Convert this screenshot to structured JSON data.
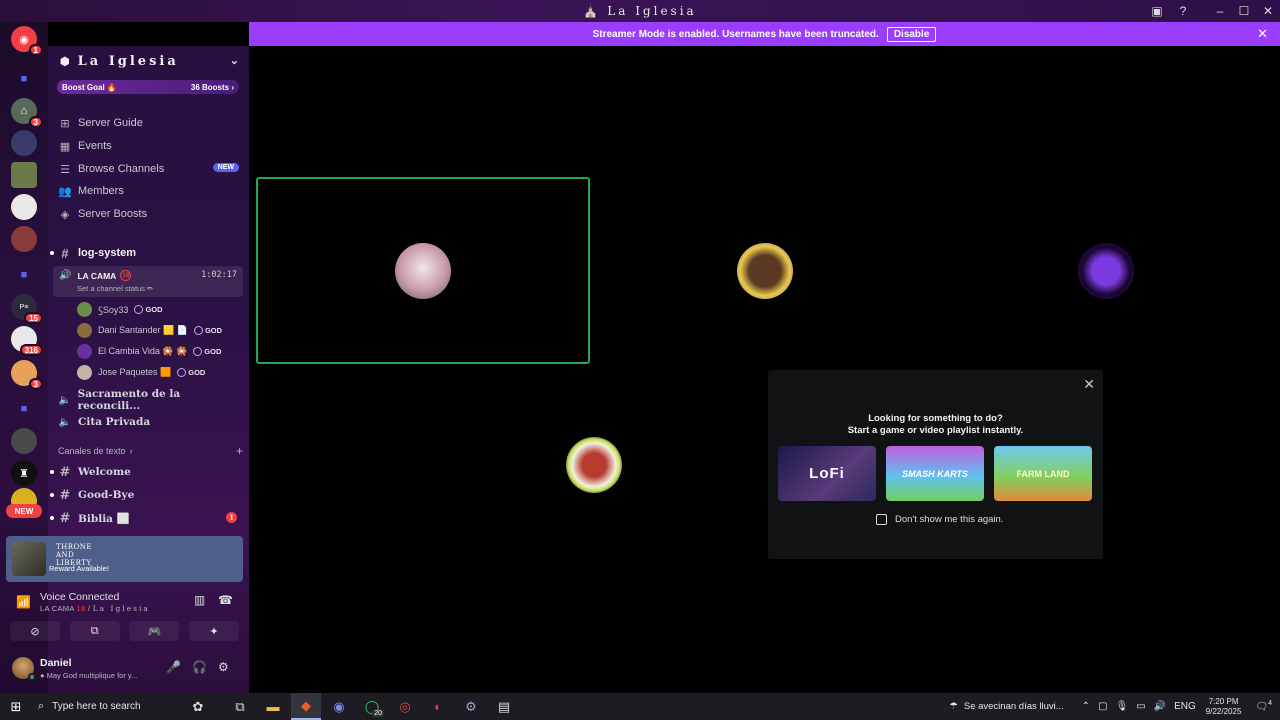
{
  "window": {
    "title": "La Iglesia",
    "icons": [
      "church-icon",
      "inbox-icon",
      "help-icon"
    ],
    "controls": [
      "minimize",
      "maximize",
      "close"
    ]
  },
  "banner": {
    "text": "Streamer Mode is enabled. Usernames have been truncated.",
    "button": "Disable"
  },
  "rail": {
    "badges": [
      "1",
      "3",
      "15",
      "316",
      "3"
    ],
    "new_label": "NEW"
  },
  "server": {
    "name": "La Iglesia",
    "boost_goal": "Boost Goal 🔥",
    "boost_count": "36 Boosts",
    "nav": [
      {
        "label": "Server Guide",
        "icon": "compass-icon"
      },
      {
        "label": "Events",
        "icon": "calendar-icon"
      },
      {
        "label": "Browse Channels",
        "icon": "list-icon",
        "tag": "NEW"
      },
      {
        "label": "Members",
        "icon": "members-icon"
      },
      {
        "label": "Server Boosts",
        "icon": "boost-icon"
      }
    ],
    "channels": {
      "log": "log-system",
      "voice_active": {
        "name": "LA CAMA",
        "age": "18",
        "timer": "1:02:17",
        "status": "Set a channel status ✏"
      },
      "members": [
        {
          "name": "ꚂSoy33",
          "role": "GOD",
          "color": "#6b8f4a"
        },
        {
          "name": "Dani Santander 🟨 📄",
          "role": "GOD",
          "color": "#8a6a3f"
        },
        {
          "name": "El Cambia Vida 🎇 🎇",
          "role": "GOD",
          "color": "#6a2fa0"
        },
        {
          "name": "Jose Paquetes 🟧",
          "role": "GOD",
          "color": "#c2b2a8"
        }
      ],
      "voice_other": [
        "Sacramento de la reconcili...",
        "Cita Privada"
      ],
      "category": "Canales de texto",
      "text": [
        {
          "name": "Welcome"
        },
        {
          "name": "Good-Bye"
        },
        {
          "name": "Biblia ⬜",
          "unread": "1"
        }
      ]
    },
    "reward": {
      "game": "THRONE AND LIBERTY",
      "text": "Reward Available!"
    },
    "voice": {
      "title": "Voice Connected",
      "channel": "LA CAMA",
      "age": "18",
      "server": "La Iglesia"
    },
    "user": {
      "name": "Daniel",
      "status": "May God multiplique for y..."
    }
  },
  "stage": {
    "tiles": [
      {
        "bg": "#e2d6c3",
        "avatar": "#d8c4cc",
        "speaking": true
      },
      {
        "bg": "#b0977a",
        "avatar": "#7a5a3a",
        "speaking": false
      },
      {
        "bg": "#2a0a4a",
        "avatar": "#5b1fb0",
        "speaking": false
      },
      {
        "bg": "#1a1110",
        "avatar": "#b83a2f",
        "speaking": false
      }
    ],
    "prompt": {
      "line1": "Looking for something to do?",
      "line2": "Start a game or video playlist instantly.",
      "cards": [
        "LoFi",
        "SMASH KARTS",
        "FARM LAND"
      ],
      "checkbox": "Don't show me this again."
    }
  },
  "taskbar": {
    "search": "Type here to search",
    "whatsapp_count": "20",
    "weather": "Se avecinan días lluvi...",
    "lang": "ENG",
    "time": "7:20 PM",
    "date": "9/22/2025",
    "notif": "4"
  }
}
